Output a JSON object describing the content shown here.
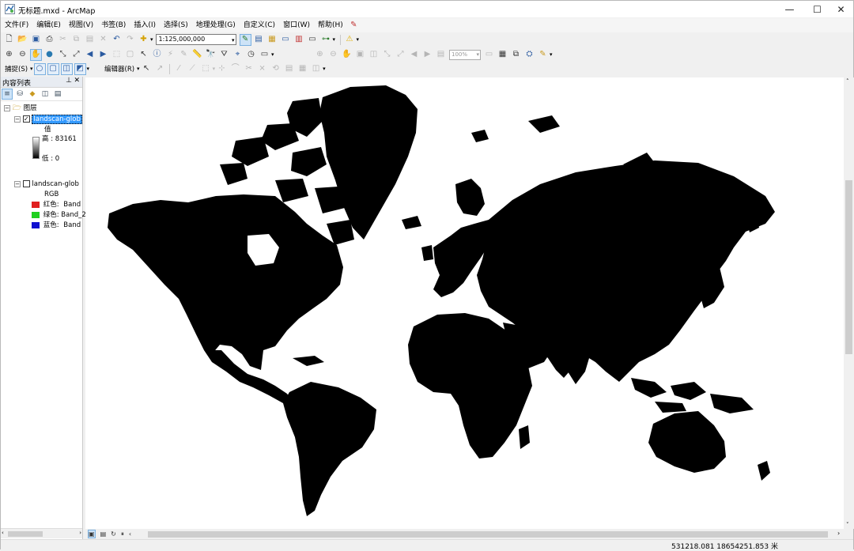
{
  "title": "无标题.mxd - ArcMap",
  "window_controls": {
    "minimize": "—",
    "maximize": "☐",
    "close": "✕"
  },
  "menu": [
    "文件(F)",
    "编辑(E)",
    "视图(V)",
    "书签(B)",
    "插入(I)",
    "选择(S)",
    "地理处理(G)",
    "自定义(C)",
    "窗口(W)",
    "帮助(H)"
  ],
  "toolbar": {
    "scale": "1:125,000,000",
    "zoom_percent": "100%",
    "snapping_label": "捕捉(S)",
    "editor_label": "编辑器(R)"
  },
  "toc": {
    "title": "内容列表",
    "layers_group": "图层",
    "layer1": {
      "name": "landscan-glob",
      "checked": true,
      "legend_title": "值",
      "high": "高 : 83161",
      "low": "低 : 0"
    },
    "layer2": {
      "name": "landscan-glob",
      "checked": false,
      "render": "RGB",
      "bands": [
        {
          "label": "红色:",
          "value": "Band",
          "color": "#e02020"
        },
        {
          "label": "绿色:",
          "value": "Band_2",
          "color": "#20d020"
        },
        {
          "label": "蓝色:",
          "value": "Band",
          "color": "#1010d0"
        }
      ]
    }
  },
  "status": {
    "coordinates": "531218.081  18654251.853 米"
  }
}
